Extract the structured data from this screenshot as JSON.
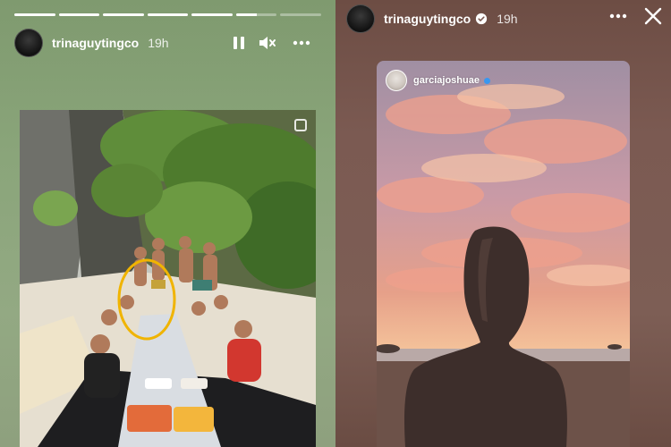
{
  "left_story": {
    "progress": [
      1,
      1,
      1,
      1,
      1,
      0.5,
      0
    ],
    "username": "trinaguytingco",
    "time": "19h",
    "icons": [
      "pause-icon",
      "mute-icon",
      "more-icon",
      "multi-photo-icon"
    ]
  },
  "right_story": {
    "username": "trinaguytingco",
    "time": "19h",
    "verified": true,
    "icons": [
      "verified-icon",
      "more-icon",
      "close-icon"
    ],
    "mention": {
      "username": "garciajoshuae",
      "verified": true
    }
  },
  "colors": {
    "left_background": "#8aa57a",
    "right_background": "#7b5a52",
    "highlight_circle": "#f0b400",
    "verified_blue": "#3897f0"
  }
}
